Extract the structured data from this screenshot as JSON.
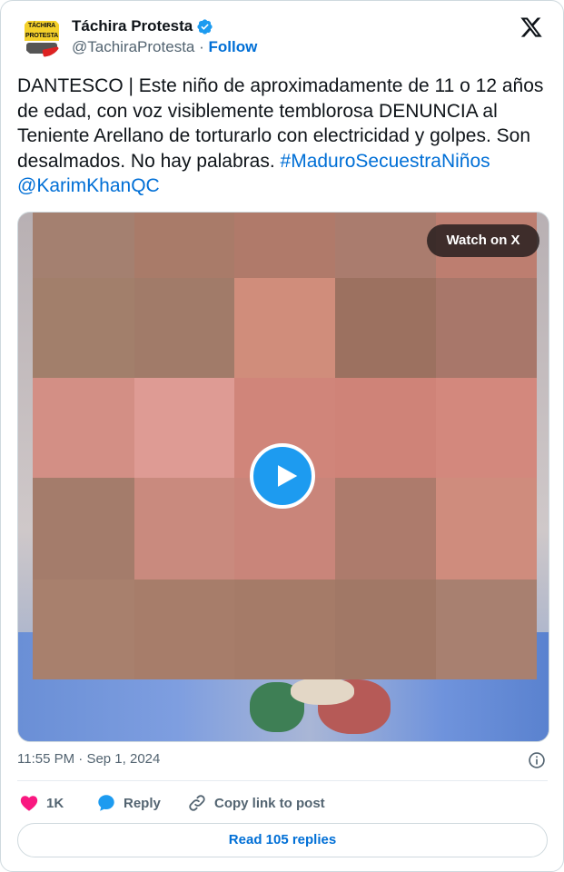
{
  "author": {
    "name": "Táchira Protesta",
    "handle": "@TachiraProtesta",
    "separator": "·",
    "follow_label": "Follow",
    "avatar_text": [
      "TÁCHIRA",
      "PROTESTA"
    ]
  },
  "tweet": {
    "text": "DANTESCO | Este niño de aproximadamente de 11 o 12 años de edad, con voz visiblemente temblorosa DENUNCIA al Teniente Arellano de torturarlo con electricidad y golpes. Son desalmados. No hay palabras.",
    "hashtag": "#MaduroSecuestraNiños",
    "mention": "@KarimKhanQC"
  },
  "media": {
    "watch_label": "Watch on X"
  },
  "meta": {
    "time": "11:55 PM",
    "separator": "·",
    "date": "Sep 1, 2024"
  },
  "actions": {
    "like_count": "1K",
    "reply_label": "Reply",
    "copy_label": "Copy link to post"
  },
  "read_replies_label": "Read 105 replies",
  "colors": {
    "accent": "#1d9bf0",
    "link": "#006fd6",
    "like": "#f91880",
    "text": "#0f1419",
    "muted": "#536471"
  },
  "icons": [
    "verified-badge-icon",
    "x-logo-icon",
    "play-icon",
    "info-icon",
    "heart-icon",
    "reply-bubble-icon",
    "link-icon"
  ]
}
